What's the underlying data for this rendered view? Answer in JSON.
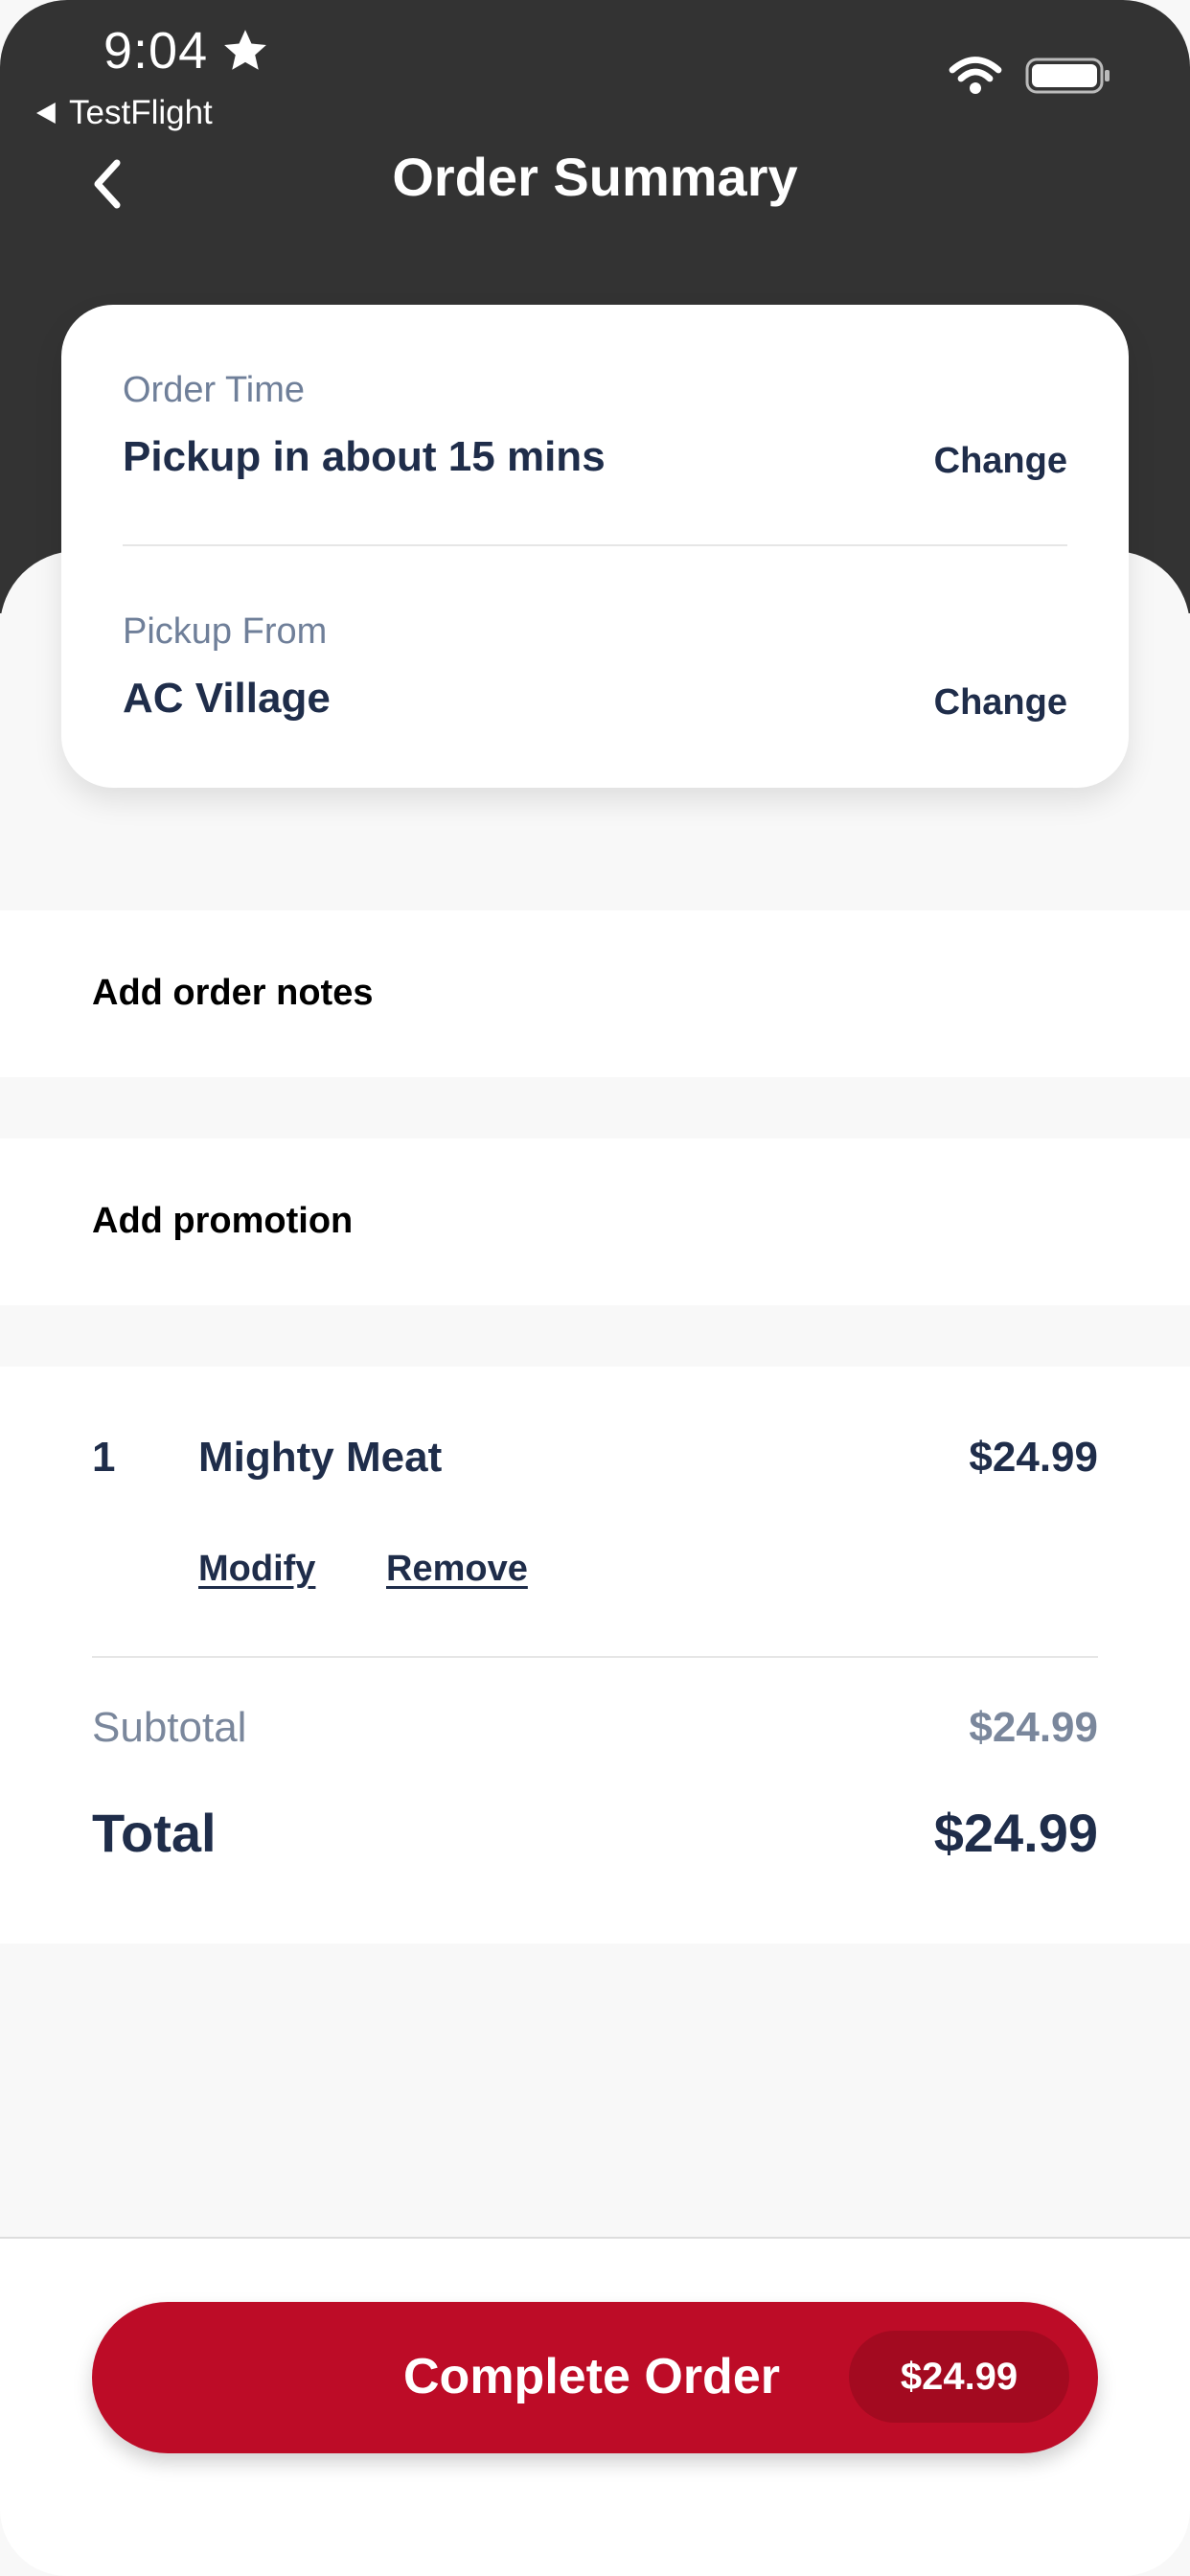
{
  "status_bar": {
    "time": "9:04",
    "back_app": "TestFlight"
  },
  "nav": {
    "title": "Order Summary"
  },
  "order_card": {
    "order_time_label": "Order Time",
    "order_time_value": "Pickup in about 15 mins",
    "order_time_change": "Change",
    "pickup_label": "Pickup From",
    "pickup_value": "AC Village",
    "pickup_change": "Change"
  },
  "options": {
    "notes": "Add order notes",
    "promotion": "Add promotion"
  },
  "items": [
    {
      "qty": "1",
      "name": "Mighty Meat",
      "price": "$24.99",
      "modify": "Modify",
      "remove": "Remove"
    }
  ],
  "totals": {
    "subtotal_label": "Subtotal",
    "subtotal_value": "$24.99",
    "total_label": "Total",
    "total_value": "$24.99"
  },
  "cta": {
    "label": "Complete Order",
    "amount": "$24.99"
  },
  "colors": {
    "header": "#333333",
    "accent": "#bd0c27",
    "accent_dark": "#a30a20",
    "text_primary": "#1f2d4a",
    "text_muted": "#6f7f99"
  }
}
